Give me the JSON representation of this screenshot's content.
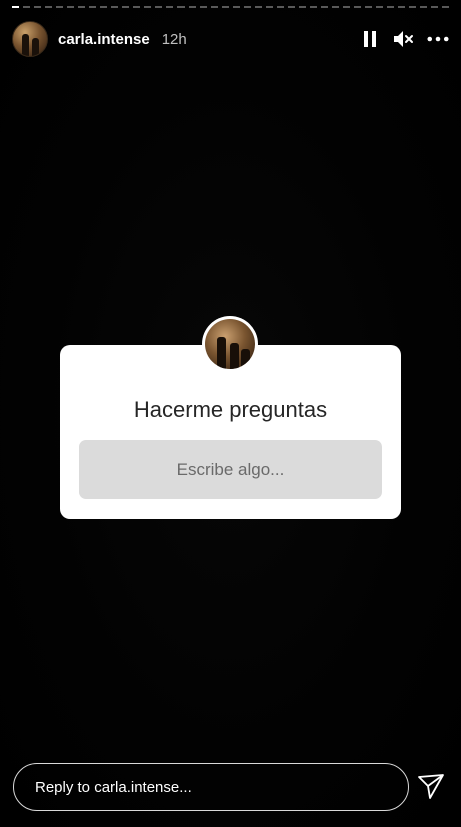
{
  "story": {
    "progress": [
      1,
      0,
      0,
      0,
      0,
      0,
      0,
      0,
      0,
      0,
      0,
      0,
      0,
      0,
      0,
      0,
      0,
      0,
      0,
      0,
      0,
      0,
      0,
      0,
      0,
      0,
      0,
      0,
      0,
      0,
      0,
      0,
      0,
      0,
      0,
      0,
      0,
      0,
      0,
      0
    ]
  },
  "header": {
    "username": "carla.intense",
    "time": "12h",
    "icons": [
      "pause-icon",
      "muted-speaker-icon",
      "more-options-icon"
    ]
  },
  "sticker": {
    "title": "Hacerme preguntas",
    "placeholder": "Escribe algo..."
  },
  "reply": {
    "placeholder": "Reply to carla.intense...",
    "send_icon": "send-icon"
  },
  "colors": {
    "background": "#000000",
    "sticker_bg": "#ffffff",
    "input_bg": "#dbdbdb"
  }
}
